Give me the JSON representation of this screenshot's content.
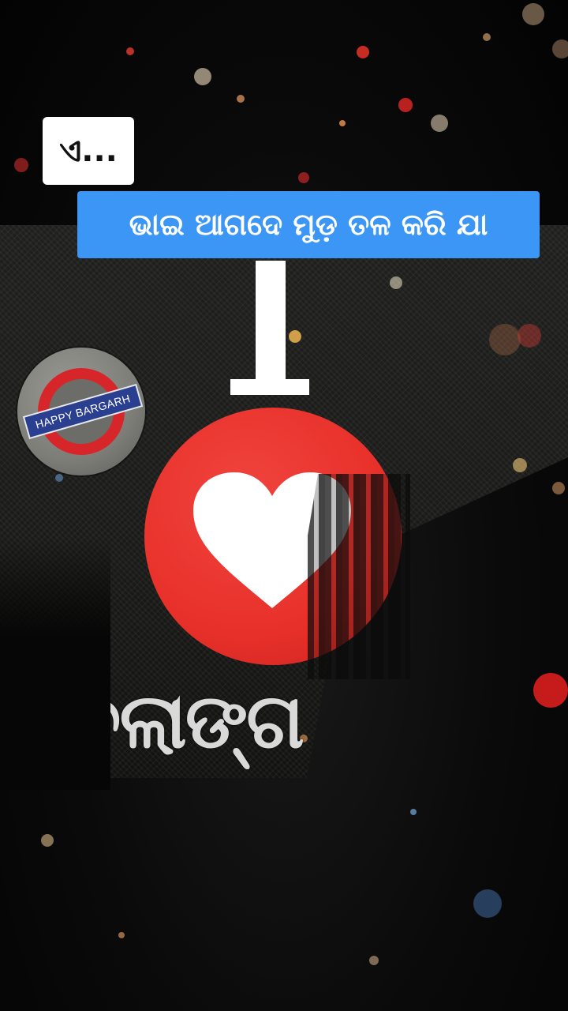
{
  "captions": {
    "small": "ଏ...",
    "main": "ଭାଇ ଆଗଦେ ମୁଡ଼ ତଳ କରି ଯା"
  },
  "logo": {
    "text": "HAPPY BARGARH"
  },
  "artwork": {
    "letter": "I",
    "symbol": "heart",
    "bottom_word": "ବଲାଙ୍ଗ"
  },
  "colors": {
    "caption_main_bg": "#3b96f5",
    "heart_circle": "#e8302a",
    "logo_ring": "#d7262a",
    "logo_bar": "#2a3f8f",
    "background": "#050505"
  }
}
